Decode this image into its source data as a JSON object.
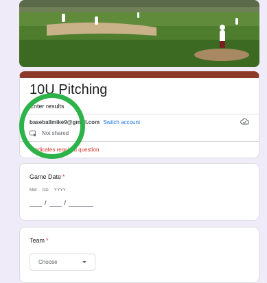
{
  "form": {
    "title": "10U Pitching",
    "description": "Enter results",
    "account_email": "baseballmike9@gmail.com",
    "switch_account_label": "Switch account",
    "share_status": "Not shared",
    "required_note": "* Indicates required question"
  },
  "questions": {
    "game_date": {
      "label": "Game Date",
      "required_mark": "*",
      "placeholders": {
        "month": "MM",
        "day": "DD",
        "year": "YYYY"
      },
      "separator": "/"
    },
    "team": {
      "label": "Team",
      "required_mark": "*",
      "dropdown_value": "Choose"
    }
  },
  "icons": {
    "cloud": "cloud-icon",
    "share": "share-icon",
    "dropdown_caret": "caret-down-icon"
  },
  "colors": {
    "header_accent": "#8c3a2a",
    "link": "#1a73e8",
    "required": "#d93025",
    "annotation_circle": "#2db34a",
    "page_background": "#f0ebf8"
  }
}
